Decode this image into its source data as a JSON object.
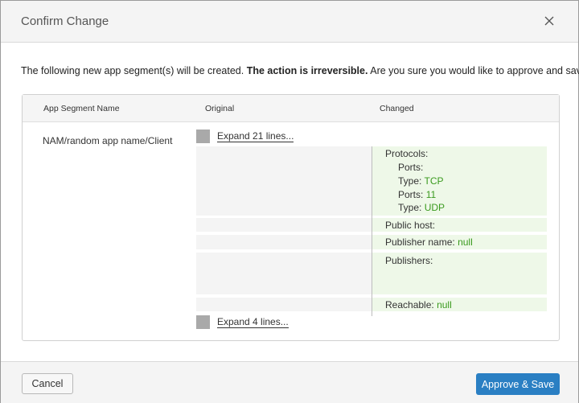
{
  "dialog": {
    "title": "Confirm Change",
    "close_icon": "close-icon"
  },
  "intro": {
    "before": "The following new app segment(s) will be created. ",
    "bold": "The action is irreversible.",
    "after": " Are you sure you would like to approve and save?"
  },
  "table": {
    "headers": [
      "App Segment Name",
      "Original",
      "Changed"
    ],
    "row": {
      "name": "NAM/random app name/Client",
      "expand_top": "Expand 21 lines...",
      "expand_bottom": "Expand 4 lines...",
      "changed": {
        "protocols_label": "Protocols:",
        "ports_label": "Ports:",
        "type1_label": "Type:",
        "type1_value": "TCP",
        "ports2_label": "Ports:",
        "ports2_value": "11",
        "type2_label": "Type:",
        "type2_value": "UDP",
        "public_host_label": "Public host:",
        "publisher_name_label": "Publisher name:",
        "publisher_name_value": "null",
        "publishers_label": "Publishers:",
        "reachable_label": "Reachable:",
        "reachable_value": "null"
      }
    }
  },
  "footer": {
    "cancel_label": "Cancel",
    "approve_label": "Approve & Save"
  },
  "colors": {
    "accent": "#2a7fc3",
    "added_value": "#3a9a1e",
    "changed_bg": "#eef8e8"
  }
}
